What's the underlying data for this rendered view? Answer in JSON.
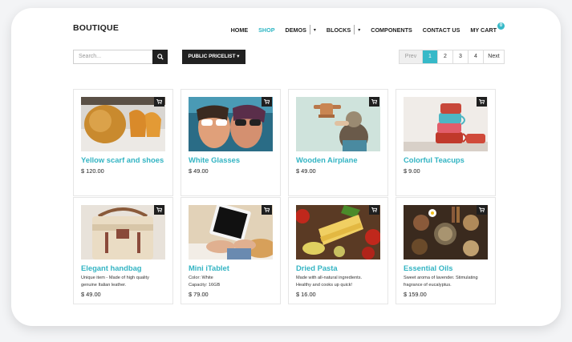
{
  "brand": "BOUTIQUE",
  "nav": {
    "home": "HOME",
    "shop": "SHOP",
    "demos": "DEMOS",
    "blocks": "BLOCKS",
    "components": "COMPONENTS",
    "contact": "CONTACT US",
    "cart": "MY CART",
    "cart_count": "0"
  },
  "toolbar": {
    "search_placeholder": "Search...",
    "pricelist_label": "PUBLIC PRICELIST ▾"
  },
  "pager": {
    "prev": "Prev",
    "pages": [
      "1",
      "2",
      "3",
      "4"
    ],
    "active": "1",
    "next": "Next"
  },
  "products": [
    {
      "name": "Yellow scarf and shoes",
      "price": "$ 120.00",
      "desc": []
    },
    {
      "name": "White Glasses",
      "price": "$ 49.00",
      "desc": []
    },
    {
      "name": "Wooden Airplane",
      "price": "$ 49.00",
      "desc": []
    },
    {
      "name": "Colorful Teacups",
      "price": "$ 9.00",
      "desc": []
    },
    {
      "name": "Elegant handbag",
      "price": "$ 49.00",
      "desc": [
        "Unique item - Made of high quality",
        "genuine Italian leather."
      ]
    },
    {
      "name": "Mini iTablet",
      "price": "$ 79.00",
      "desc": [
        "Color: White",
        "Capacity: 16GB"
      ]
    },
    {
      "name": "Dried Pasta",
      "price": "$ 16.00",
      "desc": [
        "Made with all-natural ingredients.",
        "Healthy and cooks up quick!"
      ]
    },
    {
      "name": "Essential Oils",
      "price": "$ 159.00",
      "desc": [
        "Sweet aroma of lavender. Stimulating",
        "fragrance of eucalyptus."
      ]
    }
  ],
  "colors": {
    "accent": "#36b9c8",
    "dark_button": "#212121"
  }
}
